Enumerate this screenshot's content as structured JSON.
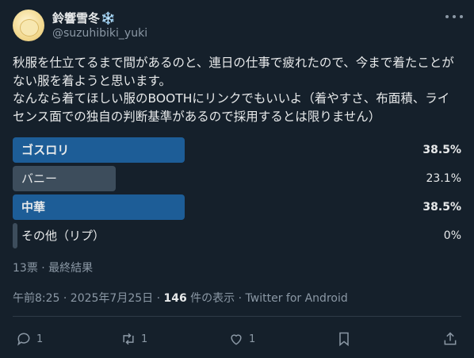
{
  "author": {
    "display_name": "鈴響雪冬",
    "emoji": "❄️",
    "handle": "@suzuhibiki_yuki"
  },
  "tweet": {
    "text": "秋服を仕立てるまで間があるのと、連日の仕事で疲れたので、今まで着たことがない服を着ようと思います。\nなんなら着てほしい服のBOOTHにリンクでもいいよ（着やすさ、布面積、ライセンス面での独自の判断基準があるので採用するとは限りません）"
  },
  "poll": {
    "options": [
      {
        "label": "ゴスロリ",
        "percent": "38.5%",
        "fraction": 0.385,
        "winner": true
      },
      {
        "label": "バニー",
        "percent": "23.1%",
        "fraction": 0.231,
        "winner": false
      },
      {
        "label": "中華",
        "percent": "38.5%",
        "fraction": 0.385,
        "winner": true
      },
      {
        "label": "その他（リプ）",
        "percent": "0%",
        "fraction": 0.0,
        "winner": false
      }
    ],
    "meta": "13票 · 最終結果"
  },
  "meta": {
    "time": "午前8:25 · 2025年7月25日 · ",
    "views_count": "146",
    "views_label": " 件の表示 · Twitter for Android"
  },
  "actions": {
    "reply_count": "1",
    "retweet_count": "1",
    "like_count": "1"
  }
}
